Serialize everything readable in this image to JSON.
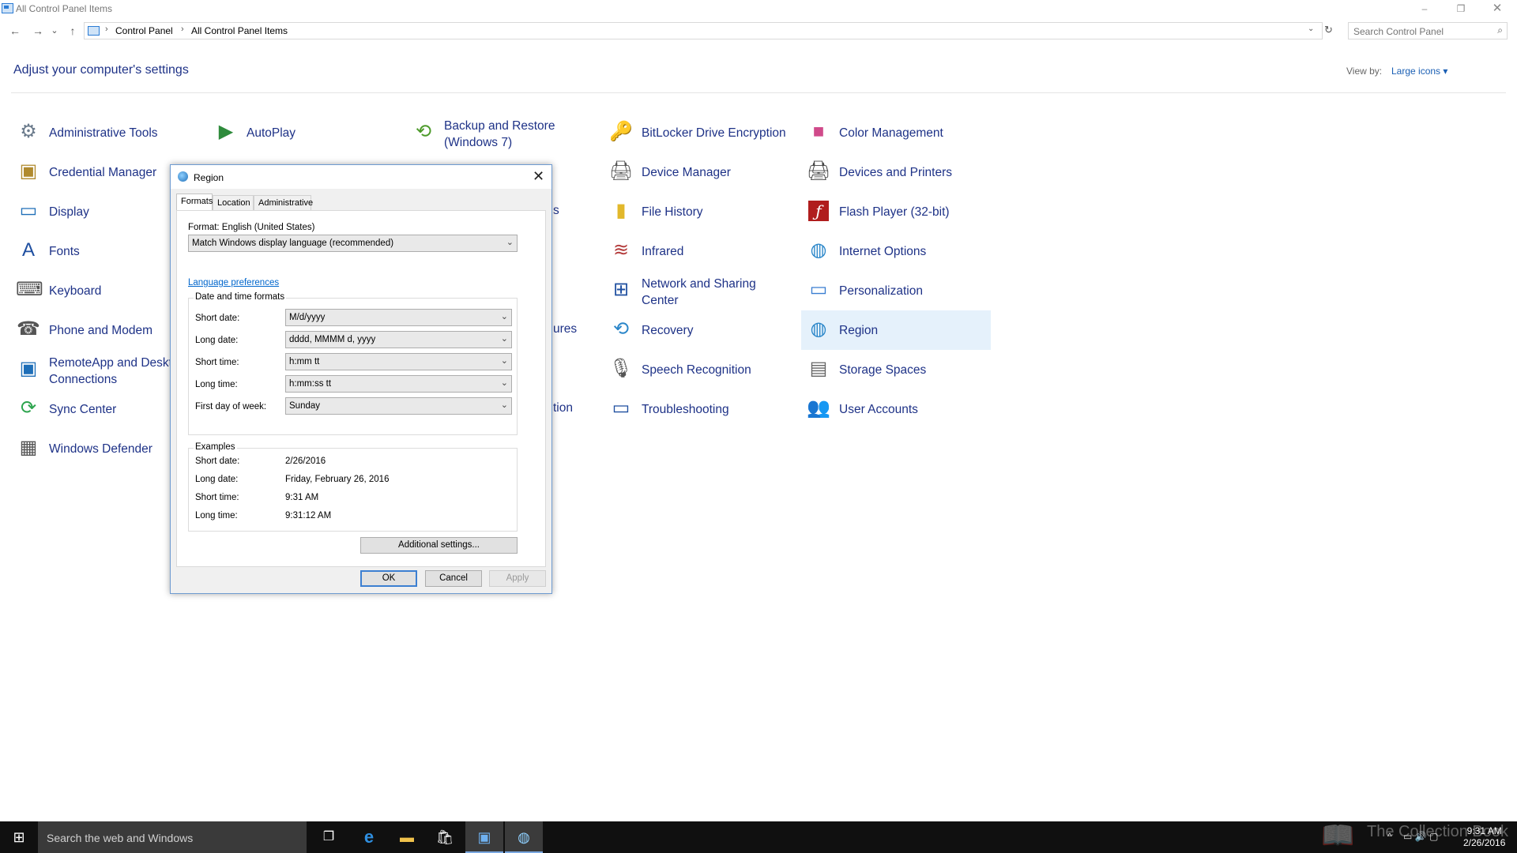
{
  "window": {
    "title": "All Control Panel Items",
    "controls": {
      "minimize": "–",
      "maximize": "❐",
      "close": "✕"
    }
  },
  "nav": {
    "back": "←",
    "forward": "→",
    "recent": "⌄",
    "up": "↑",
    "refresh": "↻",
    "dropdown": "⌄"
  },
  "breadcrumb": {
    "separator": "›",
    "items": [
      "Control Panel",
      "All Control Panel Items"
    ]
  },
  "search": {
    "placeholder": "Search Control Panel",
    "icon": "⌕"
  },
  "header": {
    "title": "Adjust your computer's settings",
    "view_by_label": "View by:",
    "view_by_value": "Large icons ▾"
  },
  "items": [
    {
      "label": "Administrative Tools",
      "icon": "⚙",
      "color": "#6b7b8c"
    },
    {
      "label": "AutoPlay",
      "icon": "▶",
      "color": "#2e8b3c"
    },
    {
      "label": "Backup and Restore (Windows 7)",
      "icon": "⟲",
      "color": "#4c9a2a"
    },
    {
      "label": "BitLocker Drive Encryption",
      "icon": "🔑",
      "color": "#a0883c"
    },
    {
      "label": "Color Management",
      "icon": "■",
      "color": "#d04a8a"
    },
    {
      "label": "Credential Manager",
      "icon": "▣",
      "color": "#b08a2e"
    },
    {
      "label": "Device Manager",
      "icon": "🖨",
      "color": "#555555"
    },
    {
      "label": "Devices and Printers",
      "icon": "🖨",
      "color": "#444444"
    },
    {
      "label": "Display",
      "icon": "▭",
      "color": "#1f6fb8"
    },
    {
      "label": "File History",
      "icon": "▮",
      "color": "#e2b82b"
    },
    {
      "label": "Flash Player (32-bit)",
      "icon": "ƒ",
      "color": "#b01d1d"
    },
    {
      "label": "Fonts",
      "icon": "A",
      "color": "#1f4fa0"
    },
    {
      "label": "Infrared",
      "icon": "≋",
      "color": "#b33a3a"
    },
    {
      "label": "Internet Options",
      "icon": "◍",
      "color": "#2a86c9"
    },
    {
      "label": "Keyboard",
      "icon": "⌨",
      "color": "#555555"
    },
    {
      "label": "Network and Sharing Center",
      "icon": "⊞",
      "color": "#1f4fa0"
    },
    {
      "label": "Personalization",
      "icon": "▭",
      "color": "#3a7ed1"
    },
    {
      "label": "Phone and Modem",
      "icon": "☎",
      "color": "#555555"
    },
    {
      "label": "Recovery",
      "icon": "⟲",
      "color": "#2a86c9"
    },
    {
      "label": "Region",
      "icon": "◍",
      "color": "#2a86c9"
    },
    {
      "label": "RemoteApp and Desktop Connections",
      "icon": "▣",
      "color": "#1f6fb8"
    },
    {
      "label": "Speech Recognition",
      "icon": "🎙",
      "color": "#555555"
    },
    {
      "label": "Storage Spaces",
      "icon": "▤",
      "color": "#666666"
    },
    {
      "label": "Sync Center",
      "icon": "⟳",
      "color": "#2da44e"
    },
    {
      "label": "Troubleshooting",
      "icon": "▭",
      "color": "#1f4fa0"
    },
    {
      "label": "User Accounts",
      "icon": "👥",
      "color": "#5a7fa0"
    },
    {
      "label": "Windows Defender",
      "icon": "▦",
      "color": "#555555"
    }
  ],
  "partial_labels": {
    "s": "s",
    "ures": "ures",
    "tion": "tion"
  },
  "dialog": {
    "title": "Region",
    "close": "✕",
    "tabs": [
      "Formats",
      "Location",
      "Administrative"
    ],
    "format_label": "Format: English (United States)",
    "format_value": "Match Windows display language (recommended)",
    "language_link": "Language preferences",
    "datetime_group": "Date and time formats",
    "rows": [
      {
        "label": "Short date:",
        "value": "M/d/yyyy"
      },
      {
        "label": "Long date:",
        "value": "dddd, MMMM d, yyyy"
      },
      {
        "label": "Short time:",
        "value": "h:mm tt"
      },
      {
        "label": "Long time:",
        "value": "h:mm:ss tt"
      },
      {
        "label": "First day of week:",
        "value": "Sunday"
      }
    ],
    "examples_group": "Examples",
    "examples": [
      {
        "label": "Short date:",
        "value": "2/26/2016"
      },
      {
        "label": "Long date:",
        "value": "Friday, February 26, 2016"
      },
      {
        "label": "Short time:",
        "value": "9:31 AM"
      },
      {
        "label": "Long time:",
        "value": "9:31:12 AM"
      }
    ],
    "additional": "Additional settings...",
    "ok": "OK",
    "cancel": "Cancel",
    "apply": "Apply",
    "arrow": "⌄"
  },
  "taskbar": {
    "start": "⊞",
    "search_placeholder": "Search the web and Windows",
    "task_view": "❐",
    "edge": "e",
    "explorer": "▬",
    "store": "🛍",
    "control_panel": "▣",
    "region": "◍",
    "tray_chevron": "^",
    "tray_icons": "▭ 🔊 ▢",
    "time": "9:31 AM",
    "date": "2/26/2016",
    "watermark": "The Collection Book"
  }
}
